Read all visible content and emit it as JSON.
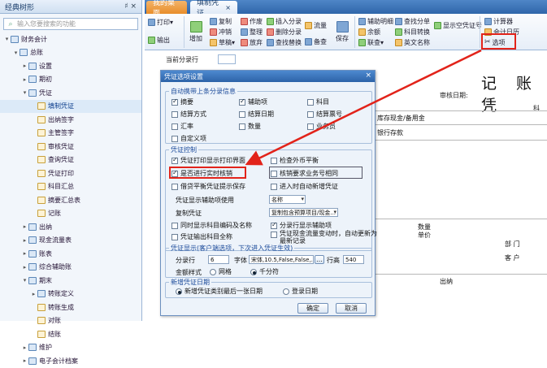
{
  "sidebar": {
    "title": "经典树形",
    "pin": "♯ ×",
    "search_placeholder": "输入您要搜索的功能",
    "tree": [
      {
        "label": "财务会计",
        "level": 0,
        "toggle": "▾",
        "type": "folder"
      },
      {
        "label": "总账",
        "level": 1,
        "toggle": "▾",
        "type": "folder"
      },
      {
        "label": "设置",
        "level": 2,
        "toggle": "▸",
        "type": "folder"
      },
      {
        "label": "期初",
        "level": 2,
        "toggle": "▸",
        "type": "folder"
      },
      {
        "label": "凭证",
        "level": 2,
        "toggle": "▾",
        "type": "folder"
      },
      {
        "label": "填制凭证",
        "level": 3,
        "toggle": "",
        "type": "doc",
        "selected": true
      },
      {
        "label": "出纳签字",
        "level": 3,
        "toggle": "",
        "type": "doc"
      },
      {
        "label": "主管签字",
        "level": 3,
        "toggle": "",
        "type": "doc"
      },
      {
        "label": "审核凭证",
        "level": 3,
        "toggle": "",
        "type": "doc"
      },
      {
        "label": "查询凭证",
        "level": 3,
        "toggle": "",
        "type": "doc"
      },
      {
        "label": "凭证打印",
        "level": 3,
        "toggle": "",
        "type": "doc"
      },
      {
        "label": "科目汇总",
        "level": 3,
        "toggle": "",
        "type": "doc"
      },
      {
        "label": "摘要汇总表",
        "level": 3,
        "toggle": "",
        "type": "doc"
      },
      {
        "label": "记账",
        "level": 3,
        "toggle": "",
        "type": "doc"
      },
      {
        "label": "出纳",
        "level": 2,
        "toggle": "▸",
        "type": "folder"
      },
      {
        "label": "现金流量表",
        "level": 2,
        "toggle": "▸",
        "type": "folder"
      },
      {
        "label": "账表",
        "level": 2,
        "toggle": "▸",
        "type": "folder"
      },
      {
        "label": "综合辅助账",
        "level": 2,
        "toggle": "▸",
        "type": "folder"
      },
      {
        "label": "期末",
        "level": 2,
        "toggle": "▾",
        "type": "folder"
      },
      {
        "label": "转账定义",
        "level": 3,
        "toggle": "▸",
        "type": "folder"
      },
      {
        "label": "转账生成",
        "level": 3,
        "toggle": "",
        "type": "doc"
      },
      {
        "label": "对账",
        "level": 3,
        "toggle": "",
        "type": "doc"
      },
      {
        "label": "结账",
        "level": 3,
        "toggle": "",
        "type": "doc"
      },
      {
        "label": "维护",
        "level": 2,
        "toggle": "▸",
        "type": "folder"
      },
      {
        "label": "电子会计档案",
        "level": 2,
        "toggle": "▸",
        "type": "folder"
      }
    ]
  },
  "tabs": {
    "desktop": "我的桌面",
    "voucher": "填制凭证",
    "close": "×"
  },
  "ribbon": {
    "print": "打印",
    "output": "输出",
    "add": "增加",
    "copy": "复制",
    "rush": "冲销",
    "draft": "草稿",
    "void": "作废",
    "tidy": "整理",
    "abandon": "放弃",
    "insert_entry": "插入分录",
    "delete_entry": "删除分录",
    "find_replace": "查找替换",
    "flow": "流量",
    "reference": "备查",
    "save": "保存",
    "aux_detail": "辅助明细",
    "balance": "余额",
    "link": "联查",
    "find_split": "查找分单",
    "subject_convert": "科目转换",
    "en_name": "英文名称",
    "show_empty": "显示空凭证号",
    "calculator": "计算器",
    "calendar": "会计日历",
    "options": "选项"
  },
  "voucher": {
    "current_entry_label": "当前分录行",
    "title": "记 账 凭",
    "audit_date": "审核日期:",
    "col_ke": "科",
    "line1": "库存现金/备用金",
    "line2": "银行存款",
    "qty": "数量",
    "price": "单价",
    "dept": "部 门",
    "customer": "客 户",
    "cashier": "出纳"
  },
  "dialog": {
    "title": "凭证选项设置",
    "close": "×",
    "g1": {
      "legend": "自动携带上条分录信息",
      "items": [
        {
          "label": "摘要",
          "checked": true
        },
        {
          "label": "辅助项",
          "checked": true
        },
        {
          "label": "科目",
          "checked": false
        },
        {
          "label": "结算方式",
          "checked": false
        },
        {
          "label": "结算日期",
          "checked": false
        },
        {
          "label": "结算票号",
          "checked": false
        },
        {
          "label": "汇率",
          "checked": false
        },
        {
          "label": "数量",
          "checked": false
        },
        {
          "label": "业务员",
          "checked": false
        },
        {
          "label": "自定义项",
          "checked": false
        }
      ]
    },
    "g2": {
      "legend": "凭证控制",
      "print_after_save": "凭证打印显示打印界面",
      "check_foreign": "检查外币平衡",
      "realtime_writeoff": "是否进行实时核销",
      "writeoff_same_biz": "核销要求业务号相同",
      "unbalanced_save": "借贷平衡凭证提示保存",
      "auto_new": "进入时自动新增凭证",
      "aux_display_label": "凭证显示辅助项使用",
      "aux_display_value": "名称",
      "copy_label": "复制凭证",
      "copy_value": "复制包含预算项目/现金...",
      "show_code_name": "同时显示科目编码及名称",
      "show_aux_in_row": "分录行显示辅助项",
      "output_full_name": "凭证输出科目全称",
      "cash_balance_line1": "凭证现金流量变动时，自动更新为",
      "cash_balance_line2": "最新记录",
      "states": {
        "print_after_save": true,
        "check_foreign": false,
        "realtime_writeoff": true,
        "writeoff_same_biz": false,
        "unbalanced_save": false,
        "auto_new": false,
        "show_code_name": false,
        "show_aux_in_row": true,
        "output_full_name": false,
        "cash_balance": false
      }
    },
    "g3": {
      "legend": "凭证显示(客户端选项，下次进入凭证生效)",
      "rows_label": "分录行",
      "rows_value": "6",
      "font_label": "字体",
      "font_value": "宋体,10.5,False,False,...",
      "height_label": "行高",
      "height_value": "540",
      "money_label": "金额样式",
      "grid": "网格",
      "thousands": "千分符",
      "money_style": "千分符"
    },
    "g4": {
      "legend": "新增凭证日期",
      "last_date": "新增凭证类别最后一张日期",
      "login_date": "登录日期",
      "selected": "新增凭证类别最后一张日期"
    },
    "ok": "确定",
    "cancel": "取消"
  },
  "colors": {
    "highlight": "#e2231a",
    "title_bar": "#2d63a8",
    "active_tab": "#e88d2b"
  }
}
